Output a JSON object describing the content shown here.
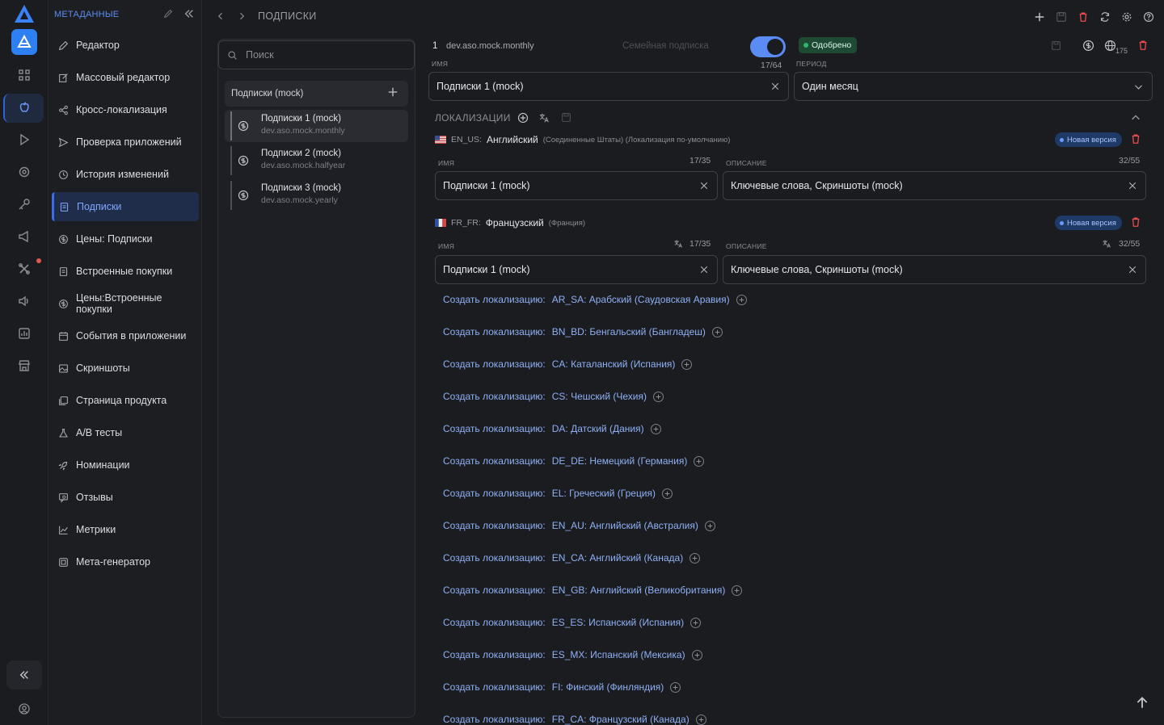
{
  "rail": {
    "icons": [
      "logo-icon",
      "app-store-icon",
      "grid-icon",
      "apple-icon",
      "play-icon",
      "target-icon",
      "key-icon",
      "megaphone-icon",
      "tools-icon",
      "sound-icon",
      "chart-icon",
      "store-icon"
    ],
    "collapse": "double-chevron-left-icon",
    "user": "user-icon"
  },
  "menu": {
    "header": "МЕТАДАННЫЕ",
    "items": [
      {
        "label": "Редактор",
        "icon": "pencil-icon"
      },
      {
        "label": "Массовый редактор",
        "icon": "edit-icon"
      },
      {
        "label": "Кросс-локализация",
        "icon": "share-icon"
      },
      {
        "label": "Проверка приложений",
        "icon": "send-icon"
      },
      {
        "label": "История изменений",
        "icon": "history-icon"
      },
      {
        "label": "Подписки",
        "icon": "doc-icon",
        "active": true
      },
      {
        "label": "Цены: Подписки",
        "icon": "dollar-icon"
      },
      {
        "label": "Встроенные покупки",
        "icon": "doc-icon"
      },
      {
        "label": "Цены:Встроенные покупки",
        "icon": "dollar-icon"
      },
      {
        "label": "События в приложении",
        "icon": "calendar-icon"
      },
      {
        "label": "Скриншоты",
        "icon": "image-icon"
      },
      {
        "label": "Страница продукта",
        "icon": "pages-icon"
      },
      {
        "label": "A/B тесты",
        "icon": "flask-icon"
      },
      {
        "label": "Номинации",
        "icon": "rocket-icon"
      },
      {
        "label": "Отзывы",
        "icon": "review-icon"
      },
      {
        "label": "Метрики",
        "icon": "metrics-icon"
      },
      {
        "label": "Мета-генератор",
        "icon": "generator-icon"
      }
    ]
  },
  "topbar": {
    "breadcrumb": "ПОДПИСКИ"
  },
  "list": {
    "search_placeholder": "Поиск",
    "group": "Подписки (mock)",
    "items": [
      {
        "title": "Подписки 1 (mock)",
        "id": "dev.aso.mock.monthly",
        "active": true
      },
      {
        "title": "Подписки 2 (mock)",
        "id": "dev.aso.mock.halfyear"
      },
      {
        "title": "Подписки 3 (mock)",
        "id": "dev.aso.mock.yearly"
      }
    ]
  },
  "detail": {
    "index": "1",
    "product_id": "dev.aso.mock.monthly",
    "family_label": "Семейная подписка",
    "toggle_on": true,
    "status": "Одобрено",
    "status_color": "#2fb86a",
    "globe_count": "175",
    "name_label": "ИМЯ",
    "name_counter": "17/64",
    "name_value": "Подписки 1 (mock)",
    "period_label": "ПЕРИОД",
    "period_value": "Один месяц",
    "localizations_title": "ЛОКАЛИЗАЦИИ",
    "locs": [
      {
        "code": "EN_US:",
        "lang": "Английский",
        "region": "(Соединенные Штаты) (Локализация по-умолчанию)",
        "badge": "Новая версия",
        "name_label": "ИМЯ",
        "name_counter": "17/35",
        "name_value": "Подписки 1 (mock)",
        "desc_label": "ОПИСАНИЕ",
        "desc_counter": "32/55",
        "desc_value": "Ключевые слова, Скриншоты (mock)"
      },
      {
        "code": "FR_FR:",
        "lang": "Французский",
        "region": "(Франция)",
        "badge": "Новая версия",
        "name_label": "ИМЯ",
        "name_counter": "17/35",
        "name_value": "Подписки 1 (mock)",
        "desc_label": "ОПИСАНИЕ",
        "desc_counter": "32/55",
        "desc_value": "Ключевые слова, Скриншоты (mock)"
      }
    ],
    "create_prefix": "Создать локализацию:",
    "create": [
      "AR_SA: Арабский (Саудовская Аравия)",
      "BN_BD: Бенгальский (Бангладеш)",
      "CA: Каталанский (Испания)",
      "CS: Чешский (Чехия)",
      "DA: Датский (Дания)",
      "DE_DE: Немецкий (Германия)",
      "EL: Греческий (Греция)",
      "EN_AU: Английский (Австралия)",
      "EN_CA: Английский (Канада)",
      "EN_GB: Английский (Великобритания)",
      "ES_ES: Испанский (Испания)",
      "ES_MX: Испанский (Мексика)",
      "FI: Финский (Финляндия)",
      "FR_CA: Французский (Канада)"
    ]
  }
}
